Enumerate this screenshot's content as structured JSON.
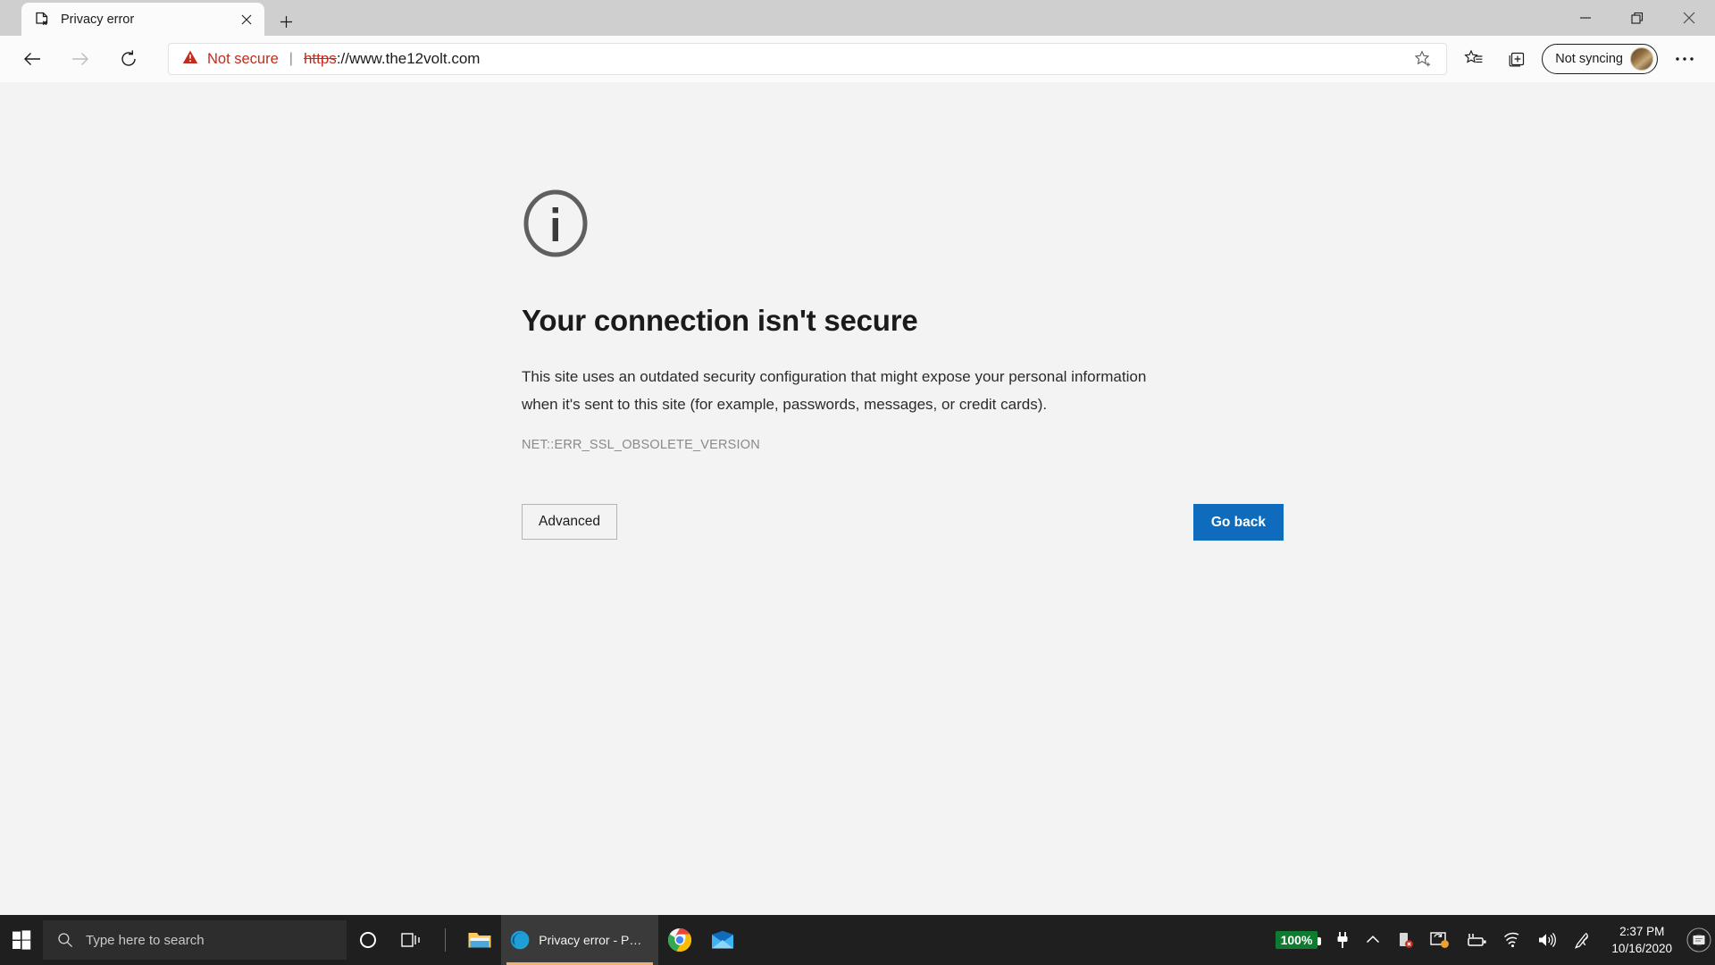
{
  "window": {
    "minimize_label": "Minimize",
    "restore_label": "Restore",
    "close_label": "Close"
  },
  "tabs": [
    {
      "title": "Privacy error",
      "favicon": "page-error-icon",
      "close_label": "Close tab"
    }
  ],
  "newtab_label": "New tab",
  "toolbar": {
    "back_label": "Back",
    "forward_label": "Forward",
    "refresh_label": "Refresh",
    "security_text": "Not secure",
    "separator": "|",
    "url_scheme": "https",
    "url_rest": "://www.the12volt.com",
    "url_full": "https://www.the12volt.com",
    "favorite_label": "Add this page to favorites",
    "favorites_label": "Favorites",
    "collections_label": "Collections",
    "profile_label": "Not syncing",
    "settings_label": "Settings and more"
  },
  "interstitial": {
    "icon": "info-circle-icon",
    "heading": "Your connection isn't secure",
    "body": "This site uses an outdated security configuration that might expose your personal information when it's sent to this site (for example, passwords, messages, or credit cards).",
    "error_code": "NET::ERR_SSL_OBSOLETE_VERSION",
    "advanced_label": "Advanced",
    "goback_label": "Go back"
  },
  "taskbar": {
    "start_label": "Start",
    "search_placeholder": "Type here to search",
    "cortana_label": "Cortana",
    "taskview_label": "Task View",
    "explorer_label": "File Explorer",
    "edge_task_label": "Privacy error - Perso...",
    "chrome_label": "Google Chrome",
    "mail_label": "Mail",
    "battery_percent": "100%",
    "time": "2:37 PM",
    "date": "10/16/2020",
    "action_center_label": "Notifications"
  },
  "colors": {
    "accent_blue": "#0f6cbd",
    "warning_red": "#c42b1c",
    "page_bg": "#f3f3f3",
    "taskbar_bg": "#1f1f1f",
    "battery_green": "#0f7b30"
  }
}
